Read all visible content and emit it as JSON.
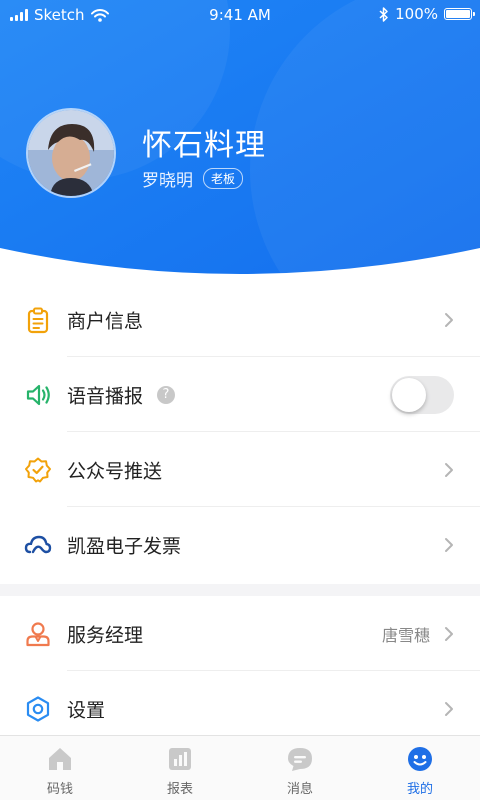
{
  "status_bar": {
    "carrier": "Sketch",
    "time": "9:41 AM",
    "battery": "100%"
  },
  "profile": {
    "shop_name": "怀石料理",
    "owner_name": "罗晓明",
    "role_badge": "老板"
  },
  "menu_group_1": [
    {
      "label": "商户信息",
      "icon": "clipboard-icon"
    },
    {
      "label": "语音播报",
      "icon": "speaker-icon",
      "toggle_on": false
    },
    {
      "label": "公众号推送",
      "icon": "verified-badge-icon"
    },
    {
      "label": "凯盈电子发票",
      "icon": "cloud-link-icon"
    }
  ],
  "menu_group_2": [
    {
      "label": "服务经理",
      "icon": "manager-person-icon",
      "value": "唐雪穗"
    },
    {
      "label": "设置",
      "icon": "settings-hexagon-icon"
    }
  ],
  "tab_bar": [
    {
      "label": "码钱",
      "icon": "home-icon"
    },
    {
      "label": "报表",
      "icon": "report-chart-icon"
    },
    {
      "label": "消息",
      "icon": "message-bubble-icon"
    },
    {
      "label": "我的",
      "icon": "profile-face-icon",
      "active": true
    }
  ],
  "colors": {
    "header_blue": "#1a7cf4",
    "active_tab": "#1f6fe6",
    "icon_orange": "#f2a20a",
    "icon_green": "#26b36a",
    "icon_navy": "#1d4fa3",
    "icon_coral": "#f07a4e",
    "icon_blue": "#2a8cf2"
  }
}
